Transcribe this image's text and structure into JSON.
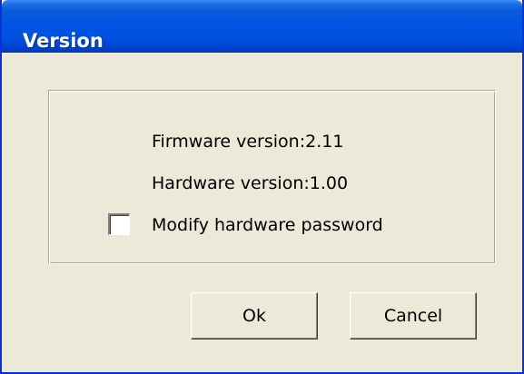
{
  "window": {
    "title": "Version"
  },
  "info": {
    "firmware": "Firmware version:2.11",
    "hardware": "Hardware version:1.00"
  },
  "checkbox": {
    "label": "Modify hardware password",
    "checked": false
  },
  "buttons": {
    "ok_label": "Ok",
    "cancel_label": "Cancel"
  },
  "colors": {
    "titlebar": "#0054E3",
    "dialog_background": "#ECE9D8",
    "title_text": "#FFFFFF"
  }
}
